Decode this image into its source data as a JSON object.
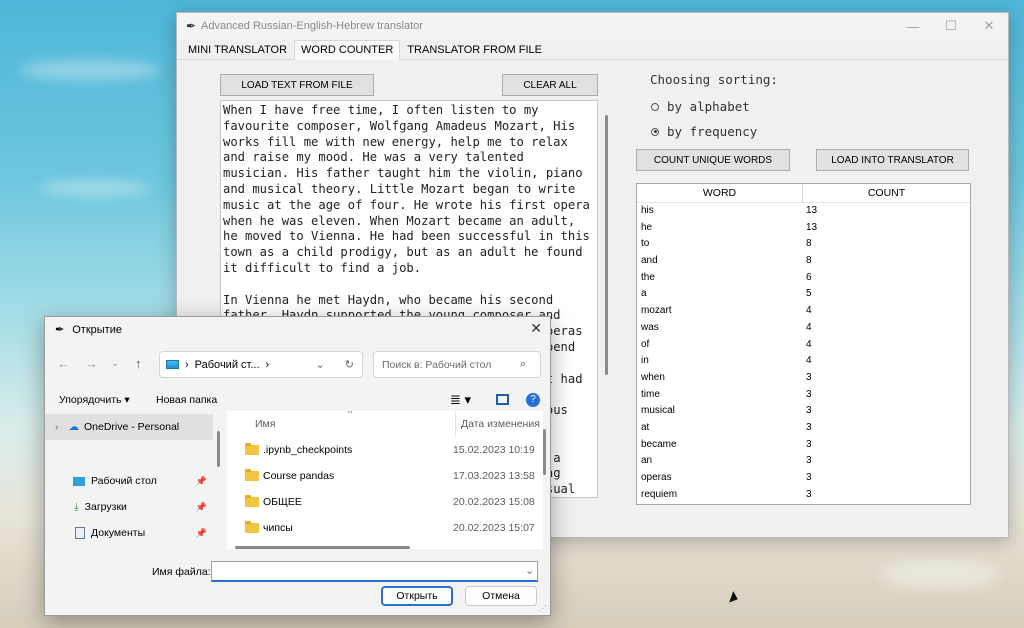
{
  "main_window": {
    "title": "Advanced Russian-English-Hebrew translator",
    "tabs": [
      {
        "label": "MINI TRANSLATOR"
      },
      {
        "label": "WORD COUNTER"
      },
      {
        "label": "TRANSLATOR FROM FILE"
      }
    ],
    "load_text_label": "LOAD TEXT FROM FILE",
    "clear_all_label": "CLEAR ALL",
    "text_content": "When I have free time, I often listen to my\nfavourite composer, Wolfgang Amadeus Mozart, His\nworks fill me with new energy, help me to relax\nand raise my mood. He was a very talented\nmusician. His father taught him the violin, piano\nand musical theory. Little Mozart began to write\nmusic at the age of four. He wrote his first opera\nwhen he was eleven. When Mozart became an adult,\nhe moved to Vienna. He had been successful in this\ntown as a child prodigy, but as an adult he found\nit difficult to find a job.\n\nIn Vienna he met Haydn, who became his second\nfather. Haydn supported the young composer and\n                                           operas\n                                           spend\n                                           n.\n                                           st had\n\n                                           mous\n\n\n                                           d a\n                                           ing\n                                           usual",
    "sorting_title": "Choosing sorting:",
    "sort_alpha": "by alphabet",
    "sort_freq": "by frequency",
    "count_unique_label": "COUNT UNIQUE WORDS",
    "load_into_label": "LOAD INTO TRANSLATOR",
    "table": {
      "col_word": "WORD",
      "col_count": "COUNT",
      "rows": [
        {
          "word": "his",
          "count": "13"
        },
        {
          "word": "he",
          "count": "13"
        },
        {
          "word": "to",
          "count": "8"
        },
        {
          "word": "and",
          "count": "8"
        },
        {
          "word": "the",
          "count": "6"
        },
        {
          "word": "a",
          "count": "5"
        },
        {
          "word": "mozart",
          "count": "4"
        },
        {
          "word": "was",
          "count": "4"
        },
        {
          "word": "of",
          "count": "4"
        },
        {
          "word": "in",
          "count": "4"
        },
        {
          "word": "when",
          "count": "3"
        },
        {
          "word": "time",
          "count": "3"
        },
        {
          "word": "musical",
          "count": "3"
        },
        {
          "word": "at",
          "count": "3"
        },
        {
          "word": "became",
          "count": "3"
        },
        {
          "word": "an",
          "count": "3"
        },
        {
          "word": "operas",
          "count": "3"
        },
        {
          "word": "requiem",
          "count": "3"
        }
      ]
    }
  },
  "dialog": {
    "title": "Открытие",
    "address": "Рабочий ст...",
    "search_placeholder": "Поиск в: Рабочий стол",
    "organize_label": "Упорядочить",
    "new_folder_label": "Новая папка",
    "sidebar": [
      {
        "label": "OneDrive - Personal"
      },
      {
        "label": "Рабочий стол"
      },
      {
        "label": "Загрузки"
      },
      {
        "label": "Документы"
      }
    ],
    "col_name": "Имя",
    "col_date": "Дата изменения",
    "files": [
      {
        "name": ".ipynb_checkpoints",
        "date": "15.02.2023 10:19"
      },
      {
        "name": "Course pandas",
        "date": "17.03.2023 13:58"
      },
      {
        "name": "ОБЩЕЕ",
        "date": "20.02.2023 15:08"
      },
      {
        "name": "чипсы",
        "date": "20.02.2023 15:07"
      }
    ],
    "filename_label": "Имя файла:",
    "filename_value": "",
    "open_label": "Открыть",
    "cancel_label": "Отмена"
  }
}
